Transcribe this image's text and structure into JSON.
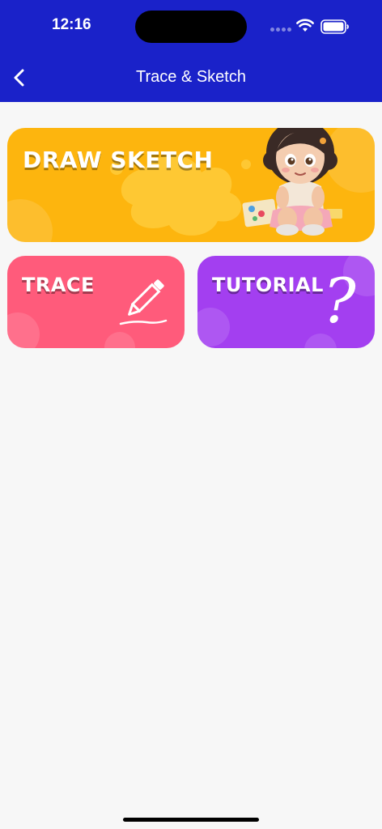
{
  "status_bar": {
    "time": "12:16"
  },
  "nav": {
    "title": "Trace & Sketch"
  },
  "cards": {
    "draw_sketch": {
      "label": "DRAW SKETCH"
    },
    "trace": {
      "label": "TRACE"
    },
    "tutorial": {
      "label": "TUTORIAL",
      "icon_glyph": "?"
    }
  },
  "colors": {
    "header": "#1a22c9",
    "draw_sketch": "#fdb50e",
    "trace": "#ff5b7b",
    "tutorial": "#a33ff0",
    "background": "#f7f7f7"
  },
  "icons": {
    "back": "chevron-left-icon",
    "wifi": "wifi-icon",
    "battery": "battery-icon",
    "trace": "pencil-icon",
    "tutorial": "question-mark-icon"
  }
}
